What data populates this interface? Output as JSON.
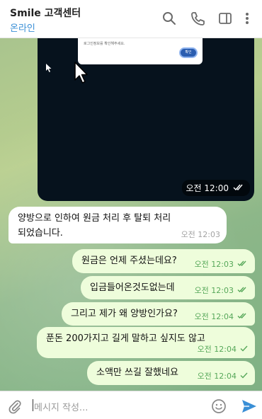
{
  "header": {
    "title": "Smile 고객센터",
    "status": "온라인",
    "icons": [
      "search-icon",
      "phone-icon",
      "sidebar-icon",
      "more-vertical-icon"
    ]
  },
  "media_message": {
    "dialog_text": "로그인정보를 확인해주세요.",
    "dialog_button": "확인",
    "time": "오전 12:00"
  },
  "messages": [
    {
      "direction": "in",
      "lines": [
        "양방으로 인하여 원금 처리 후 탈퇴 처리",
        "되었습니다."
      ],
      "time": "오전 12:03"
    },
    {
      "direction": "out",
      "lines": [
        "원금은 언제 주셨는데요?"
      ],
      "time": "오전 12:03"
    },
    {
      "direction": "out",
      "lines": [
        "입금들어온것도없는데"
      ],
      "time": "오전 12:03"
    },
    {
      "direction": "out",
      "lines": [
        "그리고 제가 왜 양방인가요?"
      ],
      "time": "오전 12:04"
    },
    {
      "direction": "out",
      "lines": [
        "푼돈 200가지고 길게 말하고 싶지도 않고"
      ],
      "time": "오전 12:04"
    },
    {
      "direction": "out",
      "lines": [
        "소액만 쓰길 잘했네요"
      ],
      "time": "오전 12:04"
    }
  ],
  "composer": {
    "placeholder": "메시지 작성..."
  },
  "colors": {
    "status": "#3a8fd6",
    "outgoing_bubble": "#eefddb",
    "outgoing_meta": "#57a85a",
    "send_button": "#3a8fd6"
  }
}
